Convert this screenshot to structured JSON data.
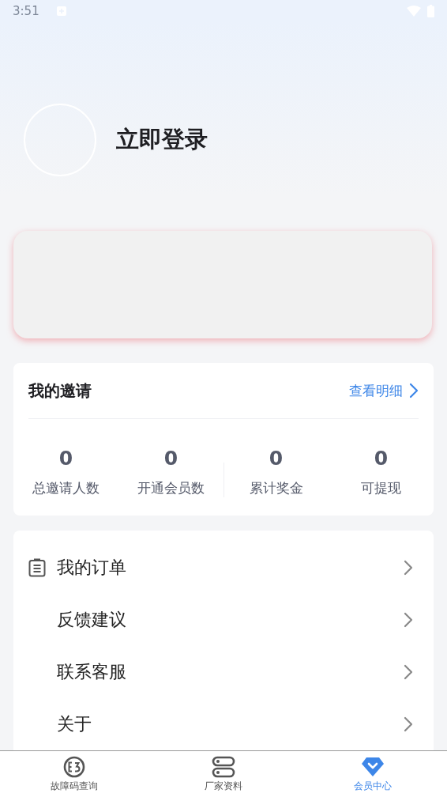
{
  "status_bar": {
    "time": "3:51"
  },
  "profile": {
    "login_label": "立即登录"
  },
  "invite": {
    "title": "我的邀请",
    "detail_link": "查看明细",
    "stats": [
      {
        "value": "0",
        "label": "总邀请人数"
      },
      {
        "value": "0",
        "label": "开通会员数"
      },
      {
        "value": "0",
        "label": "累计奖金"
      },
      {
        "value": "0",
        "label": "可提现"
      }
    ]
  },
  "menu": [
    {
      "label": "我的订单",
      "kind": "icon"
    },
    {
      "label": "反馈建议",
      "kind": "plain"
    },
    {
      "label": "联系客服",
      "kind": "plain"
    },
    {
      "label": "关于",
      "kind": "plain"
    }
  ],
  "bottom_nav": [
    {
      "label": "故障码查询",
      "kind": "code",
      "selected": false
    },
    {
      "label": "厂家资料",
      "kind": "docs",
      "selected": false
    },
    {
      "label": "会员中心",
      "kind": "member",
      "selected": true
    }
  ]
}
